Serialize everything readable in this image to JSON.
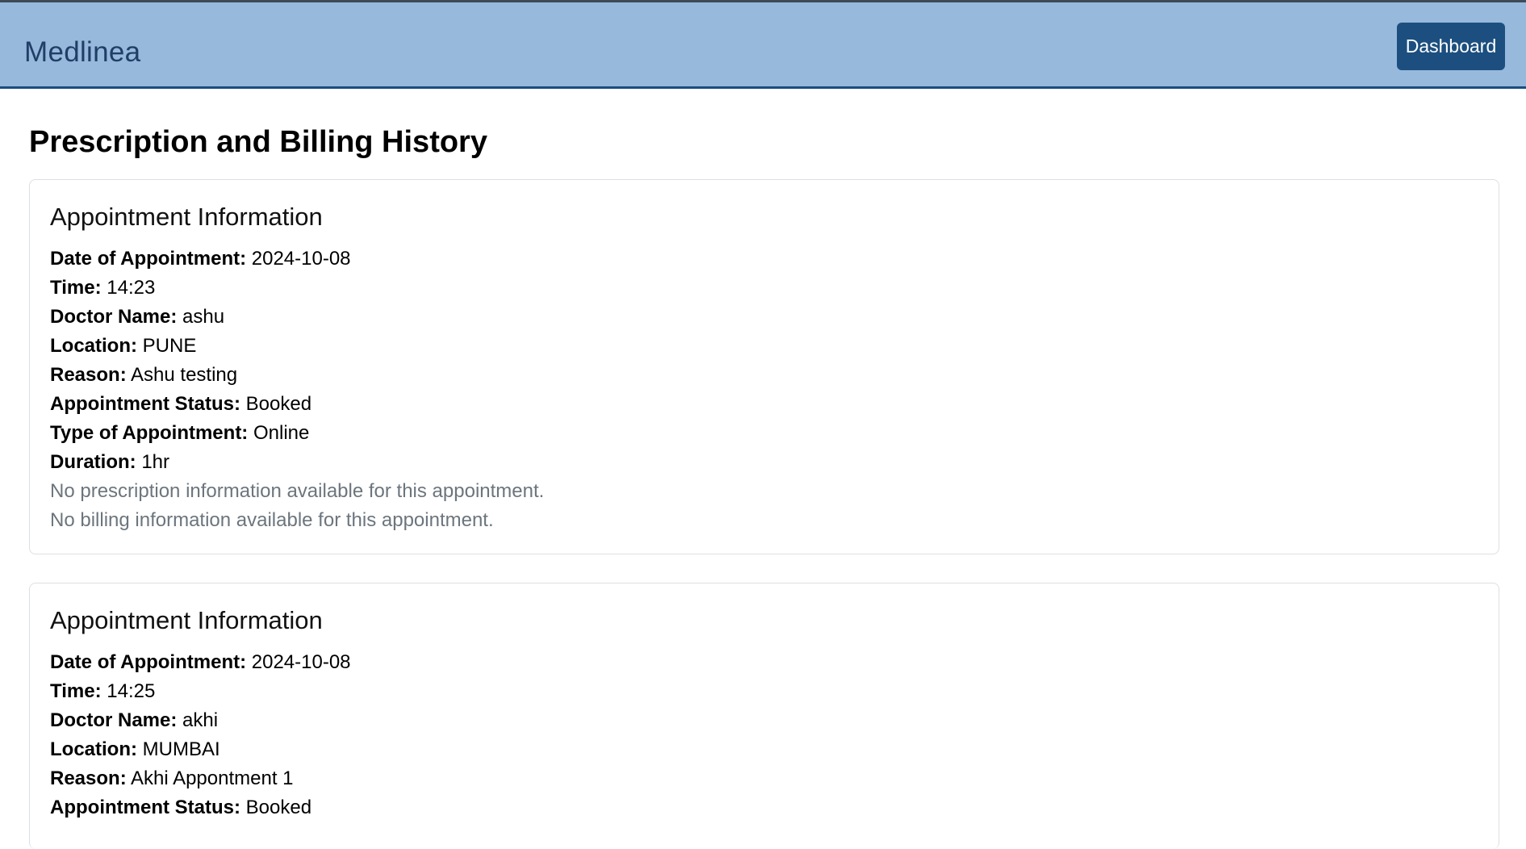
{
  "header": {
    "brand": "Medlinea",
    "dashboard_label": "Dashboard"
  },
  "page": {
    "title": "Prescription and Billing History"
  },
  "appointments": [
    {
      "title": "Appointment Information",
      "date_label": "Date of Appointment:",
      "date": "2024-10-08",
      "time_label": "Time:",
      "time": "14:23",
      "doctor_label": "Doctor Name:",
      "doctor": "ashu",
      "location_label": "Location:",
      "location": "PUNE",
      "reason_label": "Reason:",
      "reason": "Ashu testing",
      "status_label": "Appointment Status:",
      "status": "Booked",
      "type_label": "Type of Appointment:",
      "type": "Online",
      "duration_label": "Duration:",
      "duration": "1hr",
      "no_prescription": "No prescription information available for this appointment.",
      "no_billing": "No billing information available for this appointment."
    },
    {
      "title": "Appointment Information",
      "date_label": "Date of Appointment:",
      "date": "2024-10-08",
      "time_label": "Time:",
      "time": "14:25",
      "doctor_label": "Doctor Name:",
      "doctor": "akhi",
      "location_label": "Location:",
      "location": "MUMBAI",
      "reason_label": "Reason:",
      "reason": "Akhi Appontment 1",
      "status_label": "Appointment Status:",
      "status": "Booked"
    }
  ],
  "colors": {
    "header_bg": "#97b9dc",
    "brand_text": "#213f66",
    "button_bg": "#1c4f7f",
    "muted_text": "#6c757d"
  }
}
